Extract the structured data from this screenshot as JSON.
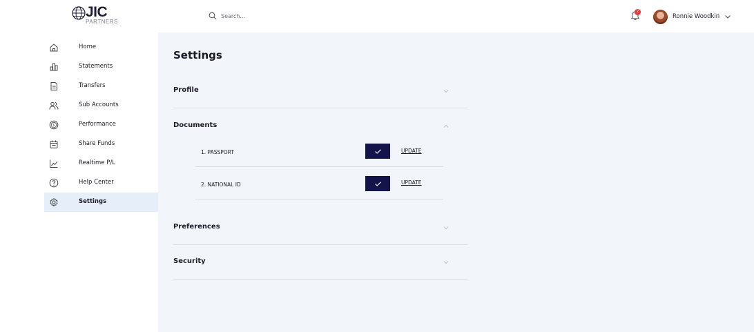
{
  "brand": {
    "name": "JIC",
    "subtitle": "PARTNERS"
  },
  "search": {
    "placeholder": "Search..."
  },
  "notifications": {
    "count": "2"
  },
  "user": {
    "name": "Ronnie Woodkin"
  },
  "sidebar": {
    "items": [
      {
        "label": "Home",
        "icon": "home-icon"
      },
      {
        "label": "Statements",
        "icon": "bar-chart-icon"
      },
      {
        "label": "Transfers",
        "icon": "document-icon"
      },
      {
        "label": "Sub Accounts",
        "icon": "users-icon"
      },
      {
        "label": "Performance",
        "icon": "dollar-circle-icon"
      },
      {
        "label": "Share Funds",
        "icon": "calendar-icon"
      },
      {
        "label": "Realtime P/L",
        "icon": "line-chart-icon"
      },
      {
        "label": "Help Center",
        "icon": "help-circle-icon"
      },
      {
        "label": "Settings",
        "icon": "gear-icon",
        "active": true
      }
    ]
  },
  "main": {
    "title": "Settings",
    "sections": [
      {
        "title": "Profile",
        "expanded": false
      },
      {
        "title": "Documents",
        "expanded": true
      },
      {
        "title": "Preferences",
        "expanded": false
      },
      {
        "title": "Security",
        "expanded": false
      }
    ],
    "documents": [
      {
        "label": "1. PASSPORT",
        "verified": true,
        "action": "UPDATE"
      },
      {
        "label": "2. NATIONAL ID",
        "verified": true,
        "action": "UPDATE"
      }
    ]
  },
  "colors": {
    "accent_dark": "#14134a",
    "active_nav_bg": "#e5eef9",
    "main_bg": "#f2f5fa",
    "badge": "#e53935"
  }
}
